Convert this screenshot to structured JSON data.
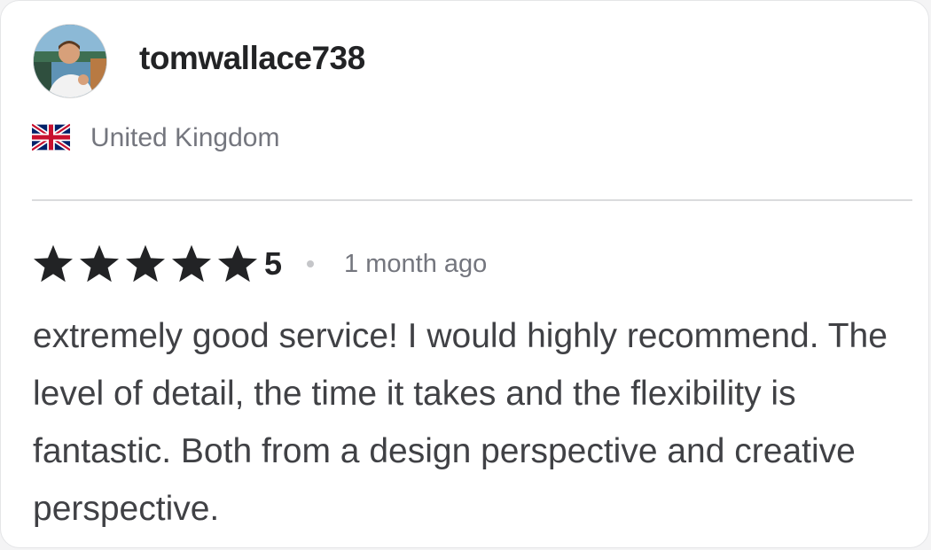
{
  "reviewer": {
    "username": "tomwallace738",
    "country": "United Kingdom",
    "avatar_icon": "user-photo-avatar",
    "flag_icon": "uk-flag-icon"
  },
  "review": {
    "rating": 5,
    "rating_label": "5",
    "stars_filled": 5,
    "stars_total": 5,
    "time_ago": "1 month ago",
    "text": "extremely good service! I would highly recommend. The level of detail, the time it takes and the flexibility is fantastic. Both from a design perspective and creative perspective."
  },
  "colors": {
    "username": "#222325",
    "muted_text": "#74767e",
    "body_text": "#404145",
    "star": "#222325",
    "divider": "#dadbdd"
  }
}
